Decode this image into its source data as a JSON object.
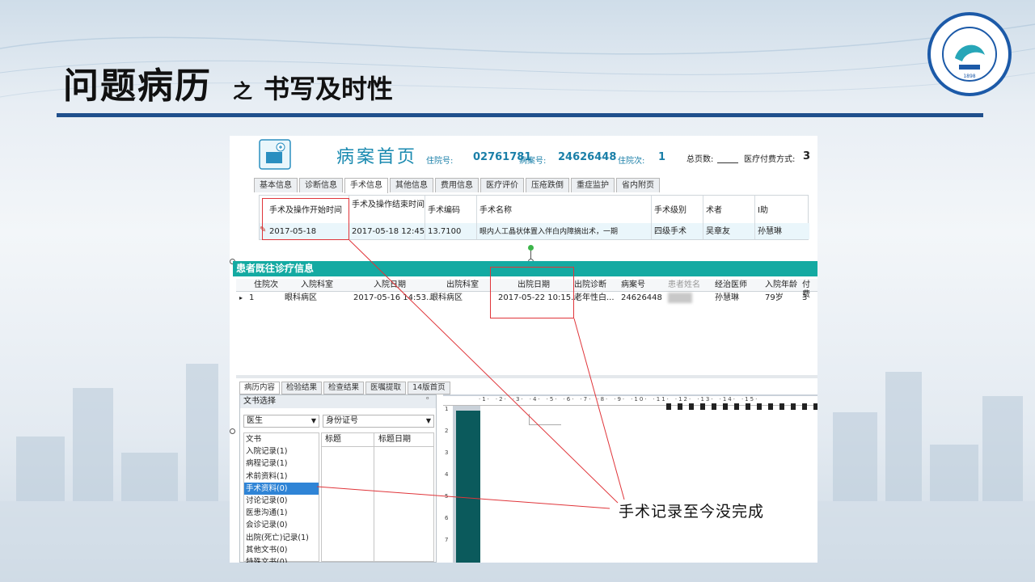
{
  "slide": {
    "title_main": "问题病历",
    "title_conj": "之",
    "title_sub": "书写及时性",
    "annotation": "手术记录至今没完成",
    "logo_year": "1898"
  },
  "header": {
    "title": "病案首页",
    "admission_no_label": "住院号:",
    "admission_no": "02761781",
    "case_no_label": "病案号:",
    "case_no": "24626448",
    "visit_count_label": "住院次:",
    "visit_count": "1",
    "total_pages_label": "总页数:",
    "payment_label": "医疗付费方式:",
    "payment_value": "3"
  },
  "tabs_top": [
    "基本信息",
    "诊断信息",
    "手术信息",
    "其他信息",
    "费用信息",
    "医疗评价",
    "压疮跌倒",
    "重症监护",
    "省内附页"
  ],
  "surgery_grid": {
    "headers": [
      "手术及操作开始时间",
      "手术及操作结束时间",
      "手术编码",
      "手术名称",
      "手术级别",
      "术者",
      "I助"
    ],
    "row": [
      "2017-05-18",
      "2017-05-18 12:45",
      "13.7100",
      "眼内人工晶状体置入伴白内障摘出术，一期",
      "四级手术",
      "吴章友",
      "孙慧琳"
    ]
  },
  "history": {
    "title": "患者既往诊疗信息",
    "headers": [
      "住院次",
      "入院科室",
      "入院日期",
      "出院科室",
      "出院日期",
      "出院诊断",
      "病案号",
      "患者姓名",
      "经治医师",
      "入院年龄",
      "付费"
    ],
    "row": [
      "1",
      "眼科病区",
      "2017-05-16 14:53...",
      "眼科病区",
      "2017-05-22 10:15...",
      "老年性白...",
      "24626448",
      "",
      "孙慧琳",
      "79岁",
      "3"
    ]
  },
  "tabs_bottom": [
    "病历内容",
    "检验结果",
    "检查结果",
    "医嘱提取",
    "14版首页"
  ],
  "doc_panel": {
    "title": "文书选择",
    "pin": "ᵒ",
    "role_select": "医生",
    "id_select": "身份证号",
    "list_header": "文书",
    "col_title": "标题",
    "col_date": "标题日期",
    "items": [
      "入院记录(1)",
      "病程记录(1)",
      "术前资料(1)",
      "手术资料(0)",
      "讨论记录(0)",
      "医患沟通(1)",
      "会诊记录(0)",
      "出院(死亡)记录(1)",
      "其他文书(0)",
      "特殊文书(0)"
    ],
    "selected_index": 3
  },
  "ruler_marks": [
    "1",
    "2",
    "3",
    "4",
    "5",
    "6",
    "7",
    "8",
    "9",
    "10",
    "11",
    "12",
    "13",
    "14",
    "15"
  ],
  "vruler_marks": [
    "1",
    "2",
    "3",
    "4",
    "5",
    "6",
    "7"
  ],
  "colors": {
    "teal": "#14aaa2",
    "title_blue": "#1a8ab0",
    "rule_blue": "#1f4f8c",
    "annotation_red": "#e0353a",
    "select_blue": "#2f84d6"
  }
}
